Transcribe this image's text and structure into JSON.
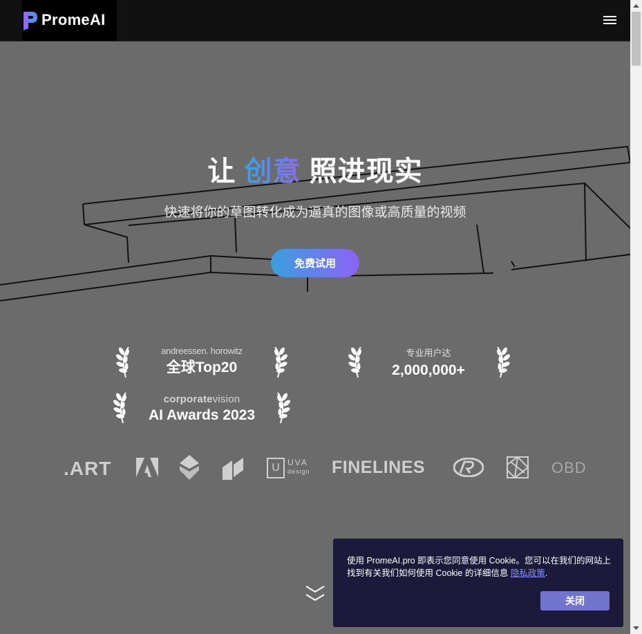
{
  "header": {
    "brand": "PromeAI",
    "menu_icon": "hamburger-menu-icon"
  },
  "hero": {
    "title_pre": "让 ",
    "title_highlight": "创意",
    "title_post": " 照进现实",
    "subtitle": "快速将你的草图转化成为逼真的图像或高质量的视频",
    "cta_label": "免费试用"
  },
  "awards": [
    {
      "top": "andreessen. horowitz",
      "main": "全球Top20"
    },
    {
      "top": "专业用户达",
      "main": "2,000,000+"
    },
    {
      "top_bold": "corporate",
      "top_light": "vision",
      "main": "AI Awards 2023"
    }
  ],
  "partner_logos": [
    {
      "text": ".ART",
      "icon": "art-logo"
    },
    {
      "text": "",
      "icon": "adobe-style-logo"
    },
    {
      "text": "",
      "icon": "stacked-diamond-logo"
    },
    {
      "text": "",
      "icon": "parallelogram-logo"
    },
    {
      "text": "U",
      "sub1": "UVA",
      "sub2": "design",
      "icon": "uva-design-logo"
    },
    {
      "text": "FINELINES",
      "icon": "finelines-logo"
    },
    {
      "text": "",
      "icon": "rp-logo"
    },
    {
      "text": "",
      "icon": "geometric-box-logo"
    },
    {
      "text": "OBD",
      "icon": "obd-logo"
    }
  ],
  "scroll_hint_icon": "double-chevron-down-icon",
  "cookie": {
    "text": "使用 PromeAI.pro 即表示您同意使用 Cookie。您可以在我们的网站上找到有关我们如何使用 Cookie 的详细信息 ",
    "link": "隐私政策",
    "after_link": ".",
    "button": "关闭"
  },
  "colors": {
    "background": "#6b6b6b",
    "header": "#111111",
    "accent_from": "#3aa0dc",
    "accent_to": "#8d63f5",
    "cookie_bg": "#1b1a3a",
    "cookie_button": "#7174cc"
  }
}
